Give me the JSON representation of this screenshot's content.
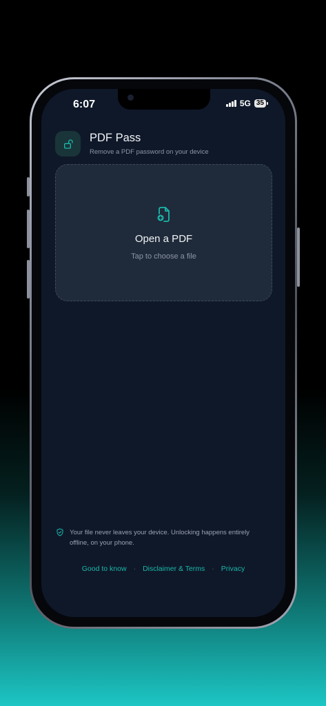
{
  "status_bar": {
    "time": "6:07",
    "network": "5G",
    "battery": "35"
  },
  "app": {
    "title": "PDF Pass",
    "subtitle": "Remove a PDF password on your device",
    "icon": "unlocked-padlock-icon"
  },
  "drop_zone": {
    "icon": "file-add-icon",
    "title": "Open a PDF",
    "subtitle": "Tap to choose a file"
  },
  "notice": {
    "icon": "shield-check-icon",
    "text": "Your file never leaves your device. Unlocking happens entirely offline, on your phone."
  },
  "footer": {
    "links": [
      "Good to know",
      "Disclaimer & Terms",
      "Privacy"
    ],
    "separator": "·"
  },
  "colors": {
    "accent": "#1ab8ab",
    "background": "#0f1829",
    "card": "#1f2b3b"
  }
}
